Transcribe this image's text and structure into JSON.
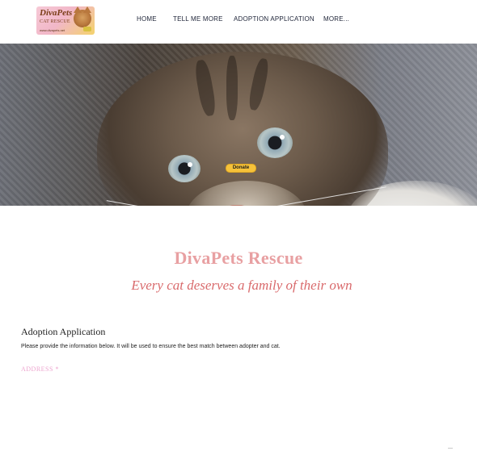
{
  "header": {
    "logo": {
      "name": "DivaPets",
      "subtitle": "CAT RESCUE",
      "url": "www.divapets.net",
      "icon": "cat-logo-icon"
    },
    "nav": [
      {
        "label": "HOME"
      },
      {
        "label": "TELL ME MORE"
      },
      {
        "label": "ADOPTION APPLICATION"
      },
      {
        "label": "MORE..."
      }
    ]
  },
  "hero": {
    "image": "kitten-photo",
    "donate_label": "Donate"
  },
  "content": {
    "title": "DivaPets Rescue",
    "tagline": "Every cat deserves a family of their own"
  },
  "form": {
    "heading": "Adoption Application",
    "description": "Please provide the information below. It will be used to ensure the best match between adopter and cat.",
    "fields": [
      {
        "label": "ADDRESS *"
      }
    ]
  },
  "colors": {
    "title": "#e8a0a2",
    "tagline": "#d96a6c",
    "field_label": "#eda5cf",
    "donate": "#f6c23a",
    "nav_text": "#1e2438"
  }
}
